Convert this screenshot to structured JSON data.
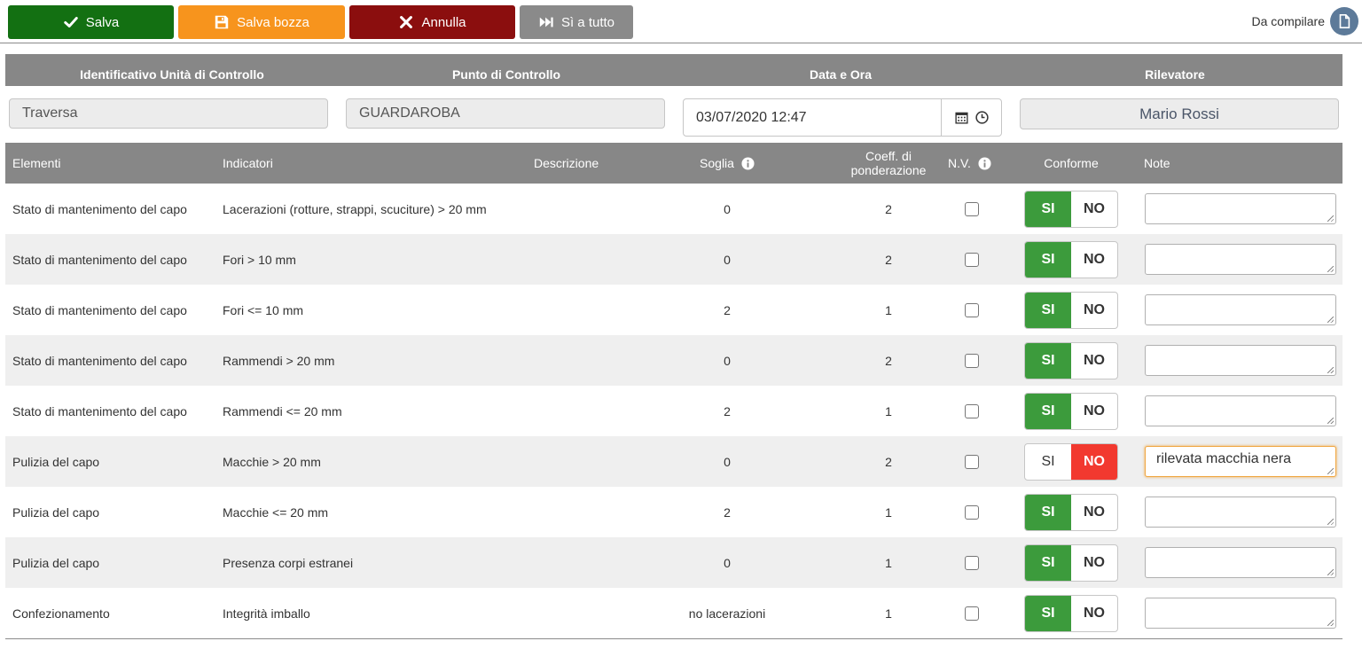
{
  "toolbar": {
    "save_label": "Salva",
    "draft_label": "Salva bozza",
    "cancel_label": "Annulla",
    "yes_all_label": "Sì a tutto",
    "status_label": "Da compilare"
  },
  "header": {
    "col1_label": "Identificativo Unità di Controllo",
    "col2_label": "Punto di Controllo",
    "col3_label": "Data e Ora",
    "col4_label": "Rilevatore",
    "unit": "Traversa",
    "point": "GUARDAROBA",
    "datetime": "03/07/2020 12:47",
    "surveyor": "Mario Rossi"
  },
  "table": {
    "columns": {
      "elementi": "Elementi",
      "indicatori": "Indicatori",
      "descrizione": "Descrizione",
      "soglia": "Soglia",
      "coeff": "Coeff. di ponderazione",
      "nv": "N.V.",
      "conforme": "Conforme",
      "note": "Note"
    },
    "yes_label": "SI",
    "no_label": "NO",
    "rows": [
      {
        "elemento": "Stato di mantenimento del capo",
        "indicatore": "Lacerazioni (rotture, strappi, scuciture) > 20 mm",
        "soglia": "0",
        "coeff": "2",
        "conforme": "SI",
        "note": ""
      },
      {
        "elemento": "Stato di mantenimento del capo",
        "indicatore": "Fori > 10 mm",
        "soglia": "0",
        "coeff": "2",
        "conforme": "SI",
        "note": ""
      },
      {
        "elemento": "Stato di mantenimento del capo",
        "indicatore": "Fori <= 10 mm",
        "soglia": "2",
        "coeff": "1",
        "conforme": "SI",
        "note": ""
      },
      {
        "elemento": "Stato di mantenimento del capo",
        "indicatore": "Rammendi > 20 mm",
        "soglia": "0",
        "coeff": "2",
        "conforme": "SI",
        "note": ""
      },
      {
        "elemento": "Stato di mantenimento del capo",
        "indicatore": "Rammendi <= 20 mm",
        "soglia": "2",
        "coeff": "1",
        "conforme": "SI",
        "note": ""
      },
      {
        "elemento": "Pulizia del capo",
        "indicatore": "Macchie > 20 mm",
        "soglia": "0",
        "coeff": "2",
        "conforme": "NO",
        "note": "rilevata macchia nera"
      },
      {
        "elemento": "Pulizia del capo",
        "indicatore": "Macchie <= 20 mm",
        "soglia": "2",
        "coeff": "1",
        "conforme": "SI",
        "note": ""
      },
      {
        "elemento": "Pulizia del capo",
        "indicatore": "Presenza corpi estranei",
        "soglia": "0",
        "coeff": "1",
        "conforme": "SI",
        "note": ""
      },
      {
        "elemento": "Confezionamento",
        "indicatore": "Integrità imballo",
        "soglia": "no lacerazioni",
        "coeff": "1",
        "conforme": "SI",
        "note": ""
      }
    ]
  }
}
